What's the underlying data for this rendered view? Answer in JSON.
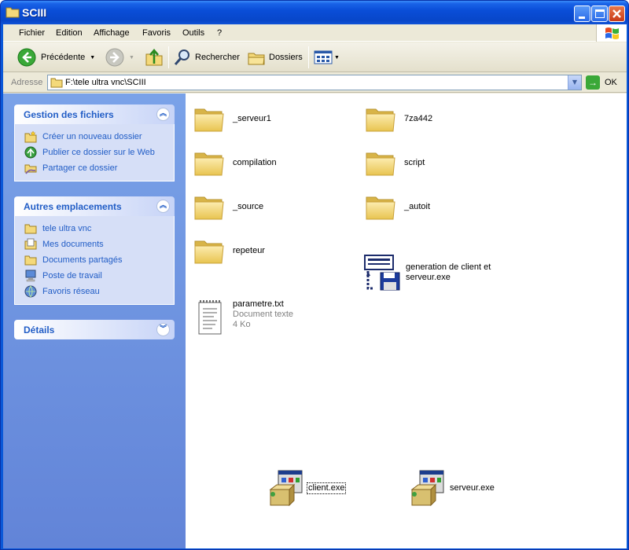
{
  "window": {
    "title": "SCIII"
  },
  "menu": {
    "items": [
      "Fichier",
      "Edition",
      "Affichage",
      "Favoris",
      "Outils",
      "?"
    ]
  },
  "toolbar": {
    "back_label": "Précédente",
    "search_label": "Rechercher",
    "folders_label": "Dossiers"
  },
  "address": {
    "label": "Adresse",
    "value": "F:\\tele ultra vnc\\SCIII",
    "go_label": "OK"
  },
  "tasks": {
    "file_tasks": {
      "title": "Gestion des fichiers",
      "items": [
        "Créer un nouveau dossier",
        "Publier ce dossier sur le Web",
        "Partager ce dossier"
      ]
    },
    "other_places": {
      "title": "Autres emplacements",
      "items": [
        "tele ultra vnc",
        "Mes documents",
        "Documents partagés",
        "Poste de travail",
        "Favoris réseau"
      ]
    },
    "details": {
      "title": "Détails"
    }
  },
  "files": [
    {
      "name": "_serveur1",
      "type": "folder"
    },
    {
      "name": "7za442",
      "type": "folder"
    },
    {
      "name": "compilation",
      "type": "folder"
    },
    {
      "name": "script",
      "type": "folder"
    },
    {
      "name": "_source",
      "type": "folder"
    },
    {
      "name": "_autoit",
      "type": "folder"
    },
    {
      "name": "repeteur",
      "type": "folder"
    },
    {
      "name": "generation de client et",
      "name2": "serveur.exe",
      "type": "exe"
    },
    {
      "name": "parametre.txt",
      "subtitle": "Document texte",
      "size": "4 Ko",
      "type": "text"
    },
    {
      "name": "client.exe",
      "type": "installer"
    },
    {
      "name": "serveur.exe",
      "type": "installer"
    }
  ],
  "colors": {
    "titlebar": "#0a4ed8",
    "task_link": "#215dc6",
    "pane": "#7aa2e8",
    "folder": "#f4d97a"
  }
}
